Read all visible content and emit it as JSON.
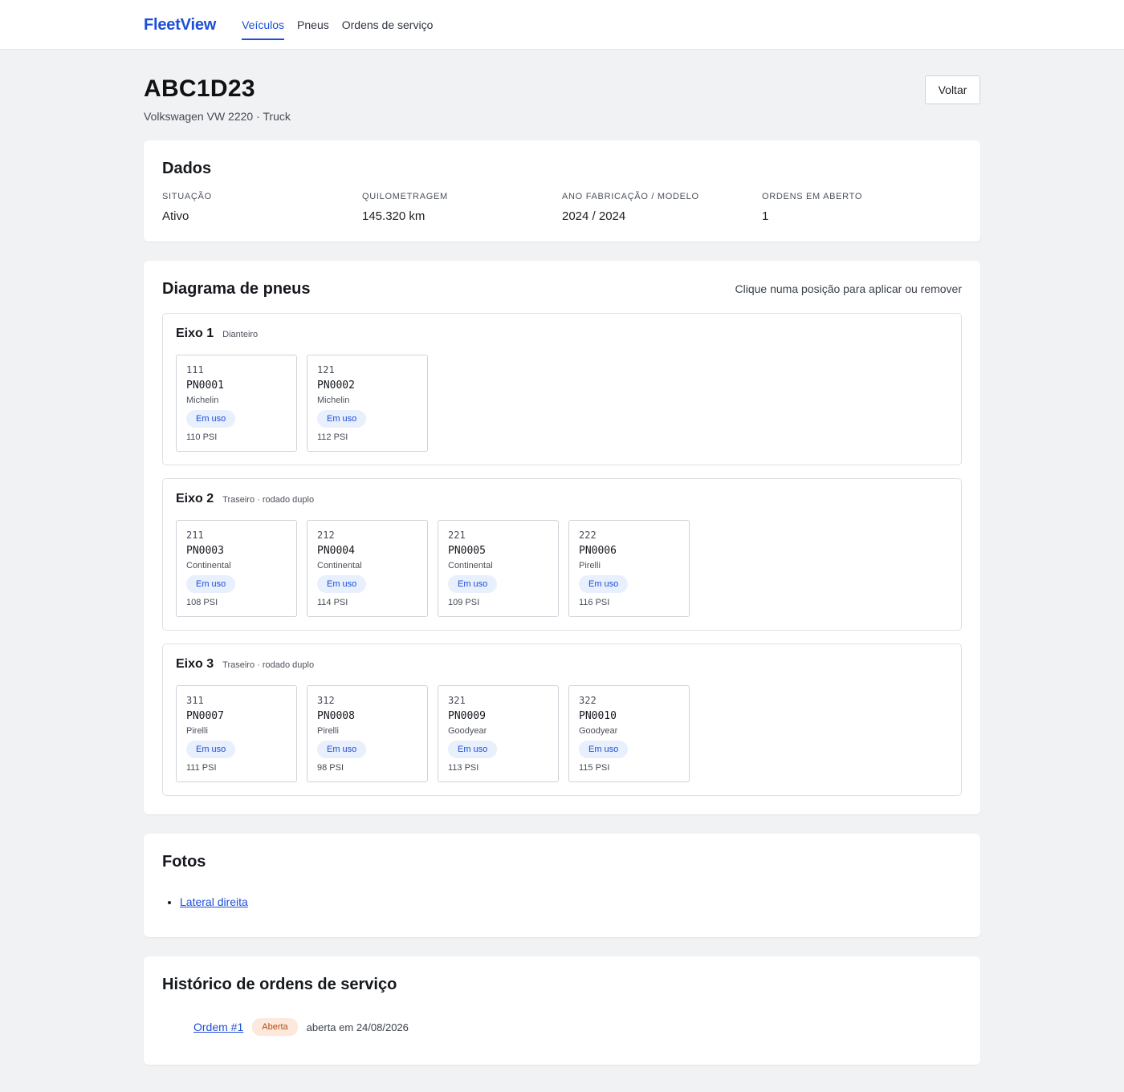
{
  "app": {
    "brand": "FleetView"
  },
  "nav": [
    {
      "label": "Veículos",
      "active": true
    },
    {
      "label": "Pneus",
      "active": false
    },
    {
      "label": "Ordens de serviço",
      "active": false
    }
  ],
  "header": {
    "plate": "ABC1D23",
    "subtitle": "Volkswagen VW 2220 · Truck",
    "back_label": "Voltar"
  },
  "dados": {
    "title": "Dados",
    "stats": [
      {
        "label": "SITUAÇÃO",
        "value": "Ativo"
      },
      {
        "label": "QUILOMETRAGEM",
        "value": "145.320 km"
      },
      {
        "label": "ANO FABRICAÇÃO / MODELO",
        "value": "2024 / 2024"
      },
      {
        "label": "ORDENS EM ABERTO",
        "value": "1"
      }
    ]
  },
  "diagram": {
    "title": "Diagrama de pneus",
    "hint": "Clique numa posição para aplicar ou remover",
    "axles": [
      {
        "name": "Eixo 1",
        "desc": "Dianteiro",
        "tires": [
          {
            "pos": "111",
            "code": "PN0001",
            "brand": "Michelin",
            "status": "Em uso",
            "psi": "110 PSI"
          },
          {
            "pos": "121",
            "code": "PN0002",
            "brand": "Michelin",
            "status": "Em uso",
            "psi": "112 PSI"
          }
        ]
      },
      {
        "name": "Eixo 2",
        "desc": "Traseiro · rodado duplo",
        "tires": [
          {
            "pos": "211",
            "code": "PN0003",
            "brand": "Continental",
            "status": "Em uso",
            "psi": "108 PSI"
          },
          {
            "pos": "212",
            "code": "PN0004",
            "brand": "Continental",
            "status": "Em uso",
            "psi": "114 PSI"
          },
          {
            "pos": "221",
            "code": "PN0005",
            "brand": "Continental",
            "status": "Em uso",
            "psi": "109 PSI"
          },
          {
            "pos": "222",
            "code": "PN0006",
            "brand": "Pirelli",
            "status": "Em uso",
            "psi": "116 PSI"
          }
        ]
      },
      {
        "name": "Eixo 3",
        "desc": "Traseiro · rodado duplo",
        "tires": [
          {
            "pos": "311",
            "code": "PN0007",
            "brand": "Pirelli",
            "status": "Em uso",
            "psi": "111 PSI"
          },
          {
            "pos": "312",
            "code": "PN0008",
            "brand": "Pirelli",
            "status": "Em uso",
            "psi": "98 PSI"
          },
          {
            "pos": "321",
            "code": "PN0009",
            "brand": "Goodyear",
            "status": "Em uso",
            "psi": "113 PSI"
          },
          {
            "pos": "322",
            "code": "PN0010",
            "brand": "Goodyear",
            "status": "Em uso",
            "psi": "115 PSI"
          }
        ]
      }
    ]
  },
  "fotos": {
    "title": "Fotos",
    "items": [
      {
        "label": "Lateral direita"
      }
    ]
  },
  "historico": {
    "title": "Histórico de ordens de serviço",
    "orders": [
      {
        "label": "Ordem #1",
        "status": "Aberta",
        "date": "aberta em 24/08/2026"
      }
    ]
  },
  "colors": {
    "accent": "#1d4ed8",
    "background": "#f1f2f4",
    "status_em_uso_bg": "#e8effd",
    "status_aberta_bg": "#fde9dc"
  }
}
